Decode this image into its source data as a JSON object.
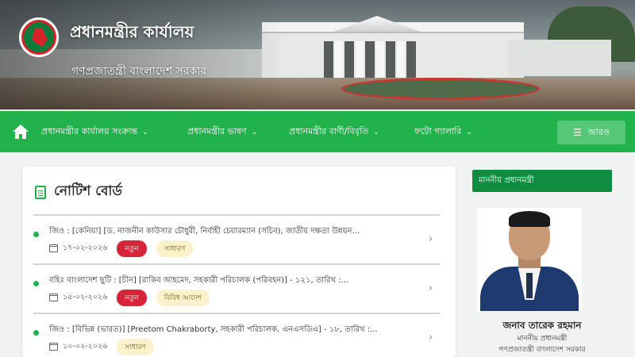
{
  "header": {
    "title": "প্রধানমন্ত্রীর কার্যালয়",
    "subtitle": "গণপ্রজাতন্ত্রী বাংলাদেশ সরকার",
    "logo_icon": "government-emblem-icon"
  },
  "nav": {
    "home_icon": "home-icon",
    "items": [
      {
        "label": "প্রধানমন্ত্রীর কার্যালয় সংক্রান্ত",
        "chevron": "⌄"
      },
      {
        "label": "প্রধানমন্ত্রীর ভাষণ",
        "chevron": "⌄"
      },
      {
        "label": "প্রধানমন্ত্রীর বাণী/বিবৃতি",
        "chevron": "⌄"
      },
      {
        "label": "ফটো গ্যালারি",
        "chevron": "⌄"
      }
    ],
    "login_label": "আরও",
    "login_icon": "menu-icon"
  },
  "notice_board": {
    "title": "নোটিশ বোর্ড",
    "icon": "document-icon",
    "items": [
      {
        "title": "জিও : [কেনিয়া] [ড. নাজনীন কাউসার চৌধুরী, নির্বাহী চেয়ারম্যান (সচিব), জাতীয় দক্ষতা উন্নয়ন...",
        "date": "১৭-০২-২০২৬",
        "new_badge": "নতুন",
        "tag": "সাধারণ"
      },
      {
        "title": "বহিঃ বাংলাদেশ ছুটি : [চীন] [রাকিব আহমেদ, সহকারী পরিচালক (পরিবহন)] - ১২১, তারিখ :...",
        "date": "১৫-০২-২০২৬",
        "new_badge": "নতুন",
        "tag": "বিবিধ আদেশ"
      },
      {
        "title": "জিও : [বিভিন্ন (ভারত)] [Preetom Chakraborty, সহকারী পরিচালক, এনএসডিএ] - ১৮, তারিখ :...",
        "date": "১০-০২-২০২৬",
        "new_badge": "",
        "tag": "সাধারণ"
      }
    ]
  },
  "pm_panel": {
    "heading": "মাননীয় প্রধানমন্ত্রী",
    "name": "জনাব তারেক রহমান",
    "role": "মাননীয় প্রধানমন্ত্রী",
    "government": "গণপ্রজাতন্ত্রী বাংলাদেশ সরকার"
  },
  "colors": {
    "nav_green": "#22b24c",
    "panel_green": "#0f8c3f",
    "new_badge": "#d6253b",
    "tag_badge": "#fbf1cd"
  }
}
